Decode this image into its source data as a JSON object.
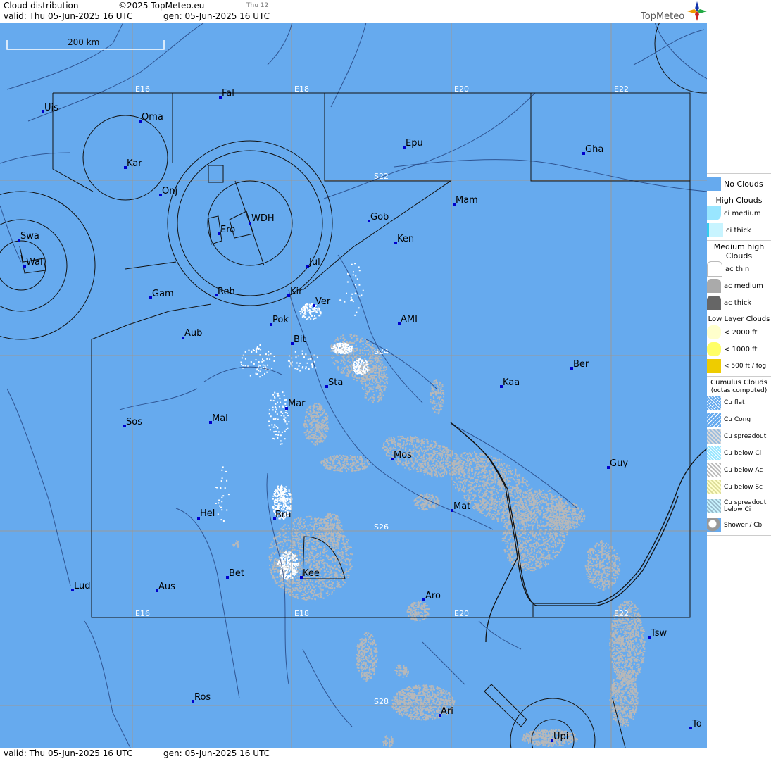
{
  "header": {
    "title": "Cloud distribution",
    "copyright": "©2025 TopMeteo.eu",
    "day_tag": "Thu 12",
    "valid": "valid:  Thu  05-Jun-2025  16 UTC",
    "gen": "gen: 05-Jun-2025 16 UTC",
    "brand": "TopMeteo"
  },
  "footer": {
    "valid": "valid:  Thu  05-Jun-2025  16 UTC",
    "gen": "gen: 05-Jun-2025 16 UTC"
  },
  "scale_bar": {
    "label": "200 km"
  },
  "colors": {
    "no_clouds": "#66AAEE",
    "cu_below_ac": "#B8B8B8",
    "cu_flat": "#FFFFFF",
    "border": "#1a1a1a",
    "station": "#0000CC"
  },
  "grid_labels": {
    "lon": [
      "E16",
      "E18",
      "E20",
      "E22"
    ],
    "lat": [
      "S22",
      "S24",
      "S26",
      "S28"
    ]
  },
  "places": [
    "Uis",
    "Fal",
    "Oma",
    "Kar",
    "Onj",
    "Epu",
    "Gha",
    "WDH",
    "Ero",
    "Swa",
    "Wal",
    "Gob",
    "Mam",
    "Ken",
    "Jul",
    "Gam",
    "Reh",
    "Kir",
    "Ver",
    "Pok",
    "AMI",
    "Aub",
    "Bit",
    "Ber",
    "Sta",
    "Kaa",
    "Mar",
    "Sos",
    "Mal",
    "Mos",
    "Guy",
    "Mat",
    "Hel",
    "Bru",
    "Bet",
    "Kee",
    "Lud",
    "Aus",
    "Aro",
    "Tsw",
    "Ros",
    "Ari",
    "To",
    "Upi"
  ],
  "legend": {
    "no_clouds": "No Clouds",
    "high_title": "High Clouds",
    "ci_medium": "ci medium",
    "ci_thick": "ci thick",
    "medium_title": "Medium high Clouds",
    "ac_thin": "ac thin",
    "ac_medium": "ac medium",
    "ac_thick": "ac thick",
    "low_title": "Low Layer Clouds",
    "low_2000": "< 2000 ft",
    "low_1000": "< 1000 ft",
    "low_500": "< 500 ft / fog",
    "cu_title": "Cumulus Clouds",
    "cu_sub": "(octas computed)",
    "cu_flat": "Cu flat",
    "cu_cong": "Cu Cong",
    "cu_spreadout": "Cu spreadout",
    "cu_below_ci": "Cu below Ci",
    "cu_below_ac": "Cu below Ac",
    "cu_below_sc": "Cu below Sc",
    "cu_spreadout_below_ci": "Cu spreadout below Ci",
    "shower": "Shower / Cb"
  }
}
